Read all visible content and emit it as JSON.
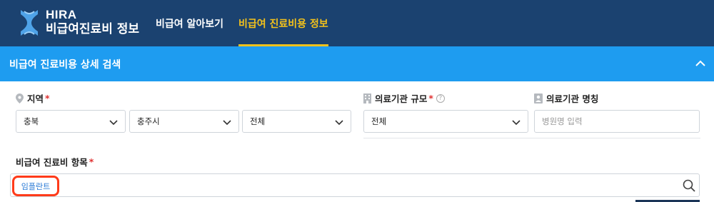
{
  "header": {
    "brand_top": "HIRA",
    "brand_bottom": "비급여진료비 정보",
    "nav": [
      {
        "label": "비급여 알아보기",
        "active": false
      },
      {
        "label": "비급여 진료비용 정보",
        "active": true
      }
    ],
    "active_color": "#f4c21b",
    "bg_color": "#1b4270"
  },
  "panel": {
    "title": "비급여 진료비용 상세 검색",
    "bg_color": "#1e9cf0",
    "collapse_icon": "chevron-up-icon"
  },
  "form": {
    "region": {
      "label": "지역",
      "required_mark": "*",
      "icon": "location-pin-icon",
      "province": "충북",
      "city": "충주시",
      "district": "전체"
    },
    "facility_size": {
      "label": "의료기관 규모",
      "required_mark": "*",
      "icon": "building-icon",
      "help_icon": "question-circle-icon",
      "help_glyph": "?",
      "value": "전체"
    },
    "facility_name": {
      "label": "의료기관 명칭",
      "icon": "id-card-icon",
      "placeholder": "병원명 입력"
    },
    "item": {
      "label": "비급여 진료비 항목",
      "required_mark": "*",
      "tag": "임플란트",
      "search_icon": "search-icon"
    }
  }
}
